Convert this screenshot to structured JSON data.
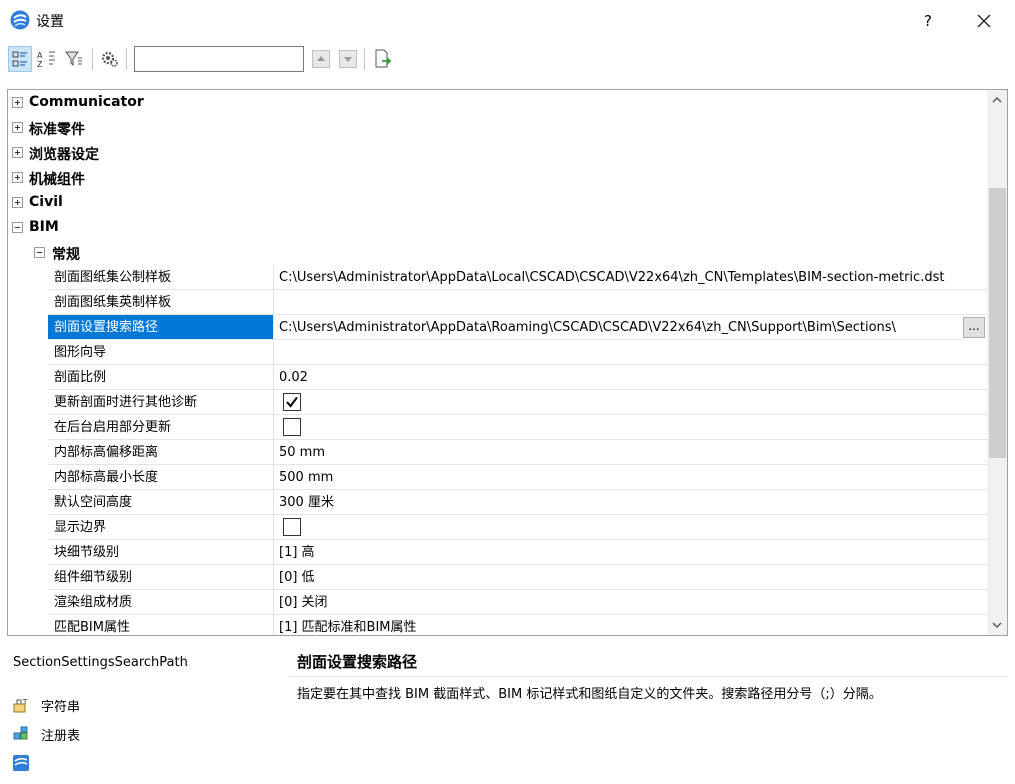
{
  "window": {
    "title": "设置",
    "help_label": "?"
  },
  "toolbar": {
    "search_value": ""
  },
  "grid": {
    "categories": [
      {
        "label": "Communicator",
        "expanded": false
      },
      {
        "label": "标准零件",
        "expanded": false
      },
      {
        "label": "浏览器设定",
        "expanded": false
      },
      {
        "label": "机械组件",
        "expanded": false
      },
      {
        "label": "Civil",
        "expanded": false
      },
      {
        "label": "BIM",
        "expanded": true
      }
    ],
    "subcategory": {
      "label": "常规",
      "expanded": true
    },
    "properties": [
      {
        "name": "剖面图纸集公制样板",
        "value": "C:\\Users\\Administrator\\AppData\\Local\\CSCAD\\CSCAD\\V22x64\\zh_CN\\Templates\\BIM-section-metric.dst"
      },
      {
        "name": "剖面图纸集英制样板",
        "value": ""
      },
      {
        "name": "剖面设置搜索路径",
        "value": "C:\\Users\\Administrator\\AppData\\Roaming\\CSCAD\\CSCAD\\V22x64\\zh_CN\\Support\\Bim\\Sections\\",
        "selected": true,
        "browse_label": "..."
      },
      {
        "name": "图形向导",
        "value": ""
      },
      {
        "name": "剖面比例",
        "value": "0.02"
      },
      {
        "name": "更新剖面时进行其他诊断",
        "checkbox": true,
        "checked": true
      },
      {
        "name": "在后台启用部分更新",
        "checkbox": true,
        "checked": false
      },
      {
        "name": "内部标高偏移距离",
        "value": "50 mm"
      },
      {
        "name": "内部标高最小长度",
        "value": "500 mm"
      },
      {
        "name": "默认空间高度",
        "value": "300 厘米"
      },
      {
        "name": "显示边界",
        "checkbox": true,
        "checked": false
      },
      {
        "name": "块细节级别",
        "value": "[1] 高"
      },
      {
        "name": "组件细节级别",
        "value": "[0] 低"
      },
      {
        "name": "渲染组成材质",
        "value": "[0] 关闭"
      },
      {
        "name": "匹配BIM属性",
        "value": "[1] 匹配标准和BIM属性"
      }
    ]
  },
  "description": {
    "key": "SectionSettingsSearchPath",
    "title": "剖面设置搜索路径",
    "text": "指定要在其中查找 BIM 截面样式、BIM 标记样式和图纸自定义的文件夹。搜索路径用分号（;）分隔。",
    "types": [
      {
        "label": "字符串",
        "icon": "string-type-icon"
      },
      {
        "label": "注册表",
        "icon": "registry-icon"
      },
      {
        "label": "",
        "icon": "app-logo-icon"
      }
    ]
  },
  "colors": {
    "selection": "#0078d7",
    "grid_line": "#e4e4e4"
  }
}
